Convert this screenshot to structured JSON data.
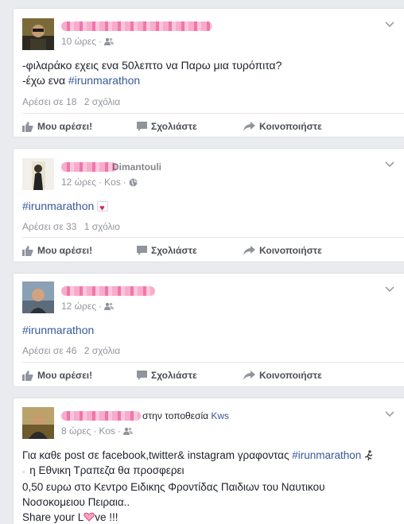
{
  "posts": [
    {
      "time": "10 ώρες",
      "privacy_icon": "friends-icon",
      "text_lines": [
        "-φιλαράκο εχεις ενα 50λεπτο να Παρω μια τυρόπιτα?",
        "-έχω ενα "
      ],
      "hashtag": "#irunmarathon",
      "likes": "Αρέσει σε 18",
      "comments": "2 σχόλια"
    },
    {
      "name_tail": "Dimantouli",
      "time": "12 ώρες",
      "location": "Kos",
      "privacy_icon": "globe-icon",
      "hashtag": "#irunmarathon",
      "likes": "Αρέσει σε 33",
      "comments": "1 σχόλιο"
    },
    {
      "time": "12 ώρες",
      "privacy_icon": "friends-icon",
      "hashtag": "#irunmarathon",
      "likes": "Αρέσει σε 46",
      "comments": "2 σχόλια"
    },
    {
      "name_tail": "στην τοποθεσία",
      "place": "Kws",
      "time": "8 ώρες",
      "location": "Kos",
      "privacy_icon": "friends-icon",
      "line1_prefix": "Για καθε post σε facebook,twitter& instagram γραφοντας ",
      "hashtag": "#irunmarathon",
      "line2": "η Εθνικη Τραπεζα θα προσφερει",
      "line3": "0,50 ευρω στο Κεντρο Ειδικης Φροντίδας Παιδιων του Ναυτικου",
      "line4": "Νοσοκομειου Πειραια..",
      "line5_a": "Share your L",
      "line5_b": "ve !!!"
    }
  ],
  "actions": {
    "like": "Μου αρέσει!",
    "comment": "Σχολιάστε",
    "share": "Κοινοποιήστε"
  },
  "meta_sep": "·",
  "colors": {
    "link": "#365899",
    "meta": "#90949c",
    "redaction": "#ef6fa5"
  }
}
